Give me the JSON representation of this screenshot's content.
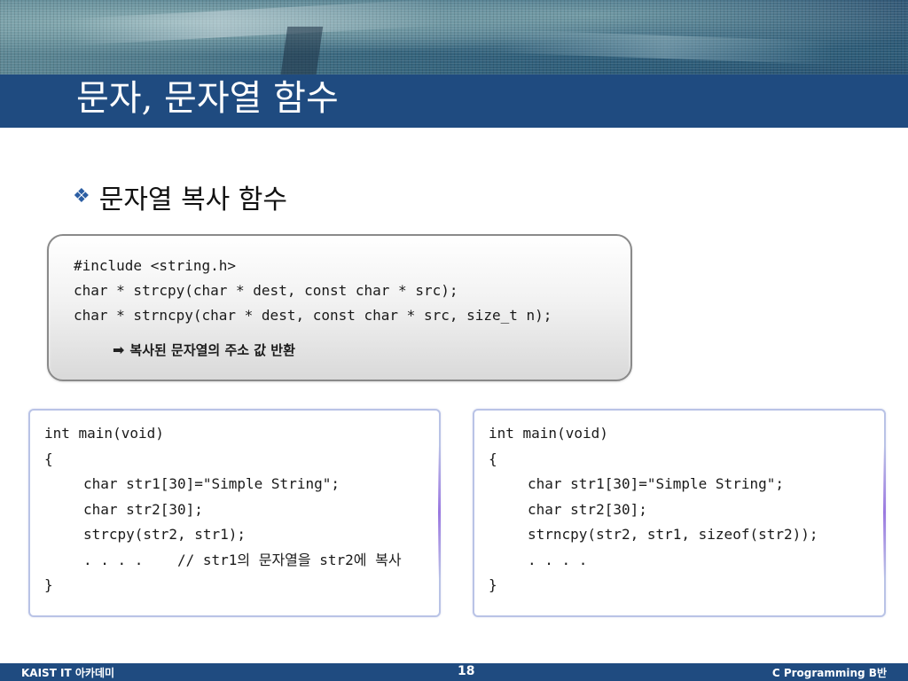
{
  "header": {
    "title": "문자, 문자열 함수"
  },
  "bullet": {
    "icon": "diamond-bullet-icon",
    "text": "문자열 복사 함수"
  },
  "prototype_box": {
    "lines": [
      "#include <string.h>",
      "char * strcpy(char * dest, const char * src);",
      "char * strncpy(char * dest, const char * src, size_t n);"
    ],
    "note": "복사된 문자열의 주소 값 반환"
  },
  "example_left": {
    "lines": [
      "int main(void)",
      "{",
      "char str1[30]=\"Simple String\";",
      "char str2[30];",
      "strcpy(str2, str1);",
      ". . . .    // str1의 문자열을 str2에 복사",
      "}"
    ]
  },
  "example_right": {
    "lines": [
      "int main(void)",
      "{",
      "char str1[30]=\"Simple String\";",
      "char str2[30];",
      "strncpy(str2, str1, sizeof(str2));",
      ". . . .",
      "}"
    ]
  },
  "footer": {
    "left": "KAIST IT 아카데미",
    "page": "18",
    "right": "C Programming B반"
  },
  "colors": {
    "title_bar": "#1f4b80",
    "bullet_icon": "#2b5ea3",
    "example_border": "#b9c3e6"
  }
}
